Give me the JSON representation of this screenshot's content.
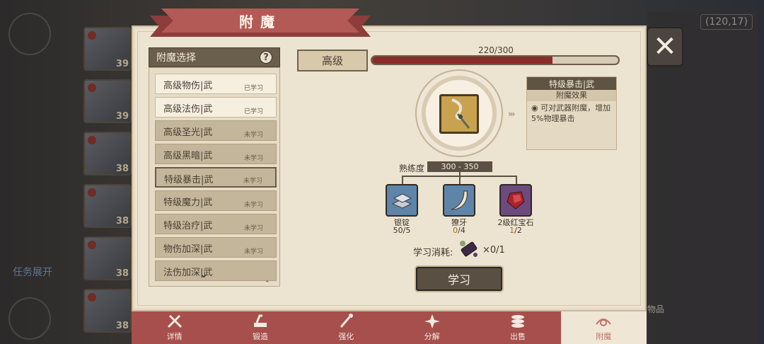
{
  "background": {
    "coord_text": "(120,17)",
    "task_text": "任务展开",
    "item_label": "物品",
    "hero_levels": [
      "39",
      "39",
      "38",
      "38",
      "38",
      "38"
    ]
  },
  "dialog": {
    "title": "附魔",
    "close_icon": "close-icon"
  },
  "selection": {
    "header": "附魔选择",
    "help": "?",
    "items": [
      {
        "name": "高级物伤|武",
        "status": "已学习",
        "learned": true
      },
      {
        "name": "高级法伤|武",
        "status": "已学习",
        "learned": true
      },
      {
        "name": "高级圣光|武",
        "status": "未学习",
        "learned": false
      },
      {
        "name": "高级黑暗|武",
        "status": "未学习",
        "learned": false
      },
      {
        "name": "特级暴击|武",
        "status": "未学习",
        "learned": false,
        "selected": true
      },
      {
        "name": "特级魔力|武",
        "status": "未学习",
        "learned": false
      },
      {
        "name": "特级治疗|武",
        "status": "未学习",
        "learned": false
      },
      {
        "name": "物伤加深|武",
        "status": "未学习",
        "learned": false
      },
      {
        "name": "法伤加深|武",
        "status": "",
        "learned": false
      }
    ]
  },
  "detail": {
    "grade": "高级",
    "progress_text": "220/300",
    "progress_value": 220,
    "progress_max": 300,
    "enchant_name": "特级暴击|武",
    "effect_title": "附魔效果",
    "effect_text": "可对武器附魔，增加5%物理暴击",
    "proficiency_label": "熟练度",
    "proficiency_range": "300 - 350",
    "materials": [
      {
        "name": "银锭",
        "have": "50",
        "need": "/5",
        "color": "blue",
        "icon": "silver-ingot-icon"
      },
      {
        "name": "獠牙",
        "have": "0",
        "need": "/4",
        "color": "blue",
        "icon": "fang-icon"
      },
      {
        "name": "2级红宝石",
        "have": "1",
        "need": "/2",
        "color": "purple",
        "icon": "ruby-icon"
      }
    ],
    "cost_label": "学习消耗:",
    "cost_count": "×0/1",
    "learn_button": "学习"
  },
  "nav": {
    "items": [
      {
        "label": "详情",
        "icon": "details-icon"
      },
      {
        "label": "锻造",
        "icon": "forge-icon"
      },
      {
        "label": "强化",
        "icon": "enhance-icon"
      },
      {
        "label": "分解",
        "icon": "decompose-icon"
      },
      {
        "label": "出售",
        "icon": "sell-icon"
      },
      {
        "label": "附魔",
        "icon": "enchant-icon",
        "active": true
      }
    ]
  }
}
